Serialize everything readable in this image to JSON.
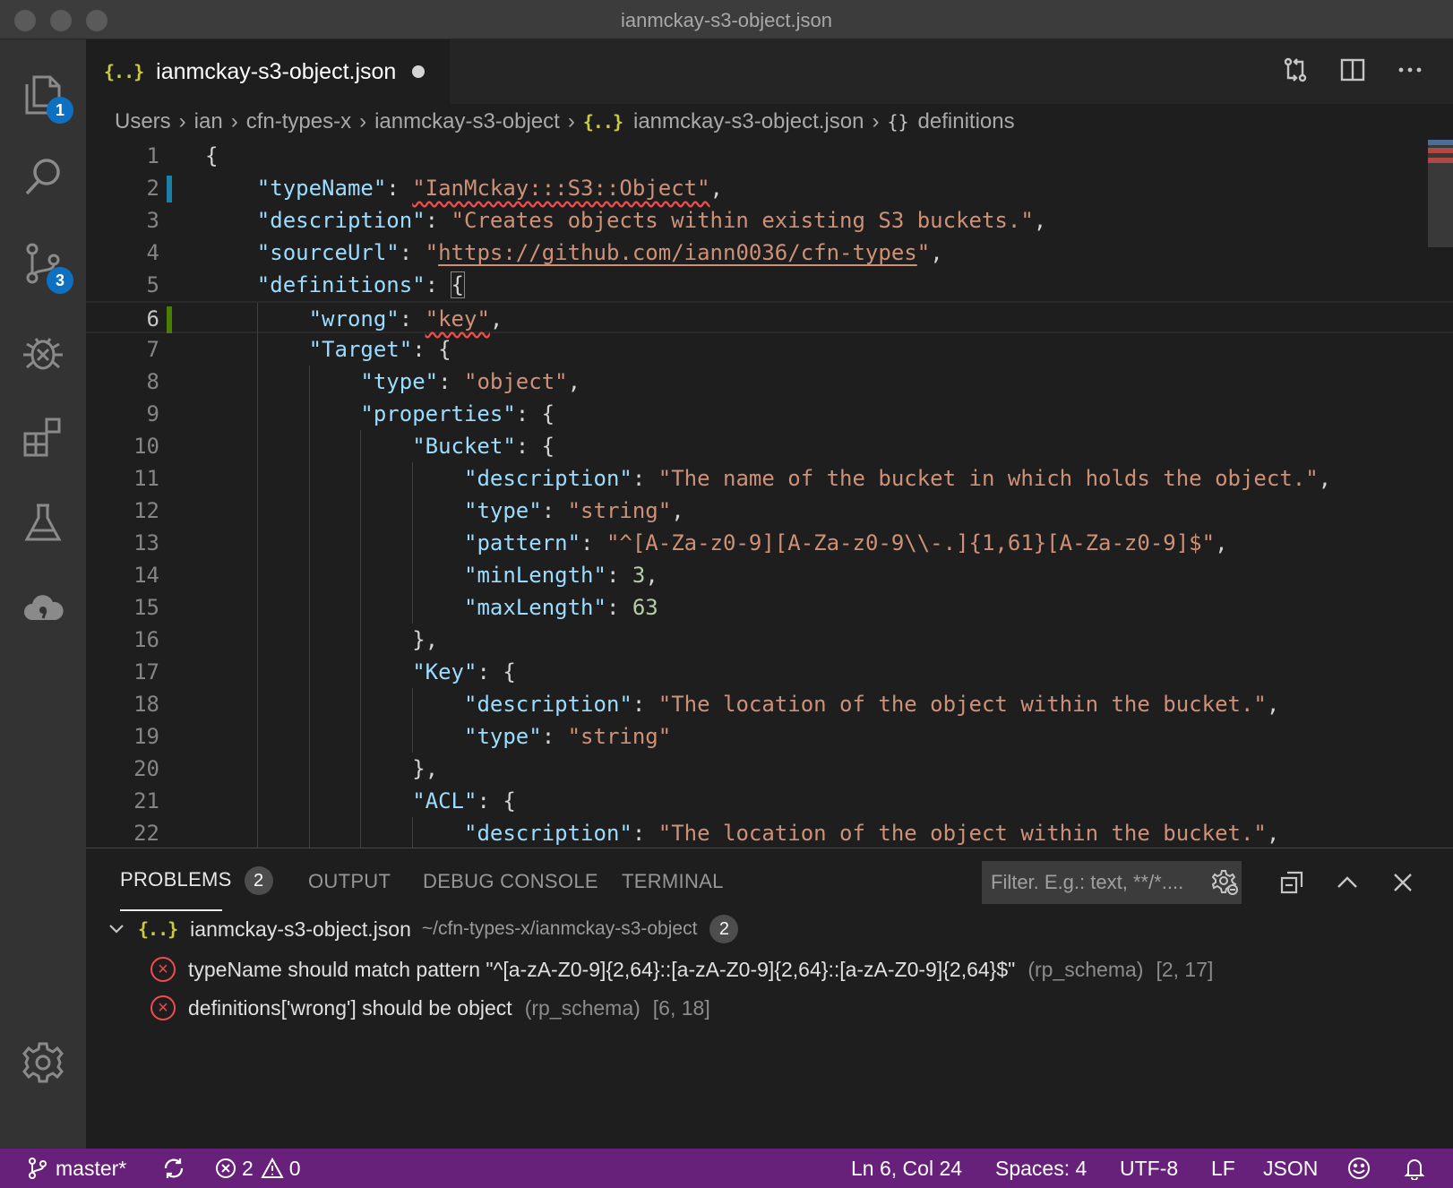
{
  "window": {
    "title": "ianmckay-s3-object.json"
  },
  "activity_bar": {
    "explorer_badge": "1",
    "scm_badge": "3"
  },
  "tab": {
    "glyph": "{..}",
    "label": "ianmckay-s3-object.json"
  },
  "breadcrumb": {
    "items": [
      "Users",
      "ian",
      "cfn-types-x",
      "ianmckay-s3-object"
    ],
    "file": "ianmckay-s3-object.json",
    "symbol_glyph": "{}",
    "symbol": "definitions"
  },
  "editor": {
    "lines": [
      {
        "n": "1",
        "indent": 0,
        "parts": [
          [
            "p",
            "{"
          ]
        ]
      },
      {
        "n": "2",
        "indent": 1,
        "parts": [
          [
            "k",
            "\"typeName\""
          ],
          [
            "p",
            ": "
          ],
          [
            "s squig",
            "\"IanMckay:::S3::Object\""
          ],
          [
            "p",
            ","
          ]
        ]
      },
      {
        "n": "3",
        "indent": 1,
        "parts": [
          [
            "k",
            "\"description\""
          ],
          [
            "p",
            ": "
          ],
          [
            "s",
            "\"Creates objects within existing S3 buckets.\""
          ],
          [
            "p",
            ","
          ]
        ]
      },
      {
        "n": "4",
        "indent": 1,
        "parts": [
          [
            "k",
            "\"sourceUrl\""
          ],
          [
            "p",
            ": "
          ],
          [
            "s",
            "\""
          ],
          [
            "s ul",
            "https://github.com/iann0036/cfn-types"
          ],
          [
            "s",
            "\""
          ],
          [
            "p",
            ","
          ]
        ]
      },
      {
        "n": "5",
        "indent": 1,
        "parts": [
          [
            "k",
            "\"definitions\""
          ],
          [
            "p",
            ": "
          ],
          [
            "p bracket-box",
            "{"
          ]
        ]
      },
      {
        "n": "6",
        "indent": 2,
        "parts": [
          [
            "k",
            "\"wrong\""
          ],
          [
            "p",
            ": "
          ],
          [
            "s squig",
            "\"key\""
          ],
          [
            "p",
            ","
          ]
        ]
      },
      {
        "n": "7",
        "indent": 2,
        "parts": [
          [
            "k",
            "\"Target\""
          ],
          [
            "p",
            ": {"
          ]
        ]
      },
      {
        "n": "8",
        "indent": 3,
        "parts": [
          [
            "k",
            "\"type\""
          ],
          [
            "p",
            ": "
          ],
          [
            "s",
            "\"object\""
          ],
          [
            "p",
            ","
          ]
        ]
      },
      {
        "n": "9",
        "indent": 3,
        "parts": [
          [
            "k",
            "\"properties\""
          ],
          [
            "p",
            ": {"
          ]
        ]
      },
      {
        "n": "10",
        "indent": 4,
        "parts": [
          [
            "k",
            "\"Bucket\""
          ],
          [
            "p",
            ": {"
          ]
        ]
      },
      {
        "n": "11",
        "indent": 5,
        "parts": [
          [
            "k",
            "\"description\""
          ],
          [
            "p",
            ": "
          ],
          [
            "s",
            "\"The name of the bucket in which holds the object.\""
          ],
          [
            "p",
            ","
          ]
        ]
      },
      {
        "n": "12",
        "indent": 5,
        "parts": [
          [
            "k",
            "\"type\""
          ],
          [
            "p",
            ": "
          ],
          [
            "s",
            "\"string\""
          ],
          [
            "p",
            ","
          ]
        ]
      },
      {
        "n": "13",
        "indent": 5,
        "parts": [
          [
            "k",
            "\"pattern\""
          ],
          [
            "p",
            ": "
          ],
          [
            "s",
            "\"^[A-Za-z0-9][A-Za-z0-9\\\\-.]{1,61}[A-Za-z0-9]$\""
          ],
          [
            "p",
            ","
          ]
        ]
      },
      {
        "n": "14",
        "indent": 5,
        "parts": [
          [
            "k",
            "\"minLength\""
          ],
          [
            "p",
            ": "
          ],
          [
            "n",
            "3"
          ],
          [
            "p",
            ","
          ]
        ]
      },
      {
        "n": "15",
        "indent": 5,
        "parts": [
          [
            "k",
            "\"maxLength\""
          ],
          [
            "p",
            ": "
          ],
          [
            "n",
            "63"
          ]
        ]
      },
      {
        "n": "16",
        "indent": 4,
        "parts": [
          [
            "p",
            "},"
          ]
        ]
      },
      {
        "n": "17",
        "indent": 4,
        "parts": [
          [
            "k",
            "\"Key\""
          ],
          [
            "p",
            ": {"
          ]
        ]
      },
      {
        "n": "18",
        "indent": 5,
        "parts": [
          [
            "k",
            "\"description\""
          ],
          [
            "p",
            ": "
          ],
          [
            "s",
            "\"The location of the object within the bucket.\""
          ],
          [
            "p",
            ","
          ]
        ]
      },
      {
        "n": "19",
        "indent": 5,
        "parts": [
          [
            "k",
            "\"type\""
          ],
          [
            "p",
            ": "
          ],
          [
            "s",
            "\"string\""
          ]
        ]
      },
      {
        "n": "20",
        "indent": 4,
        "parts": [
          [
            "p",
            "},"
          ]
        ]
      },
      {
        "n": "21",
        "indent": 4,
        "parts": [
          [
            "k",
            "\"ACL\""
          ],
          [
            "p",
            ": {"
          ]
        ]
      },
      {
        "n": "22",
        "indent": 5,
        "parts": [
          [
            "k",
            "\"description\""
          ],
          [
            "p",
            ": "
          ],
          [
            "s",
            "\"The location of the object within the bucket.\""
          ],
          [
            "p",
            ","
          ]
        ]
      }
    ]
  },
  "panel": {
    "tabs": {
      "problems": "PROBLEMS",
      "problems_count": "2",
      "output": "OUTPUT",
      "debug_console": "DEBUG CONSOLE",
      "terminal": "TERMINAL"
    },
    "filter_placeholder": "Filter. E.g.: text, **/*....",
    "file": {
      "glyph": "{..}",
      "name": "ianmckay-s3-object.json",
      "path": "~/cfn-types-x/ianmckay-s3-object",
      "count": "2"
    },
    "problems": [
      {
        "message": "typeName should match pattern \"^[a-zA-Z0-9]{2,64}::[a-zA-Z0-9]{2,64}::[a-zA-Z0-9]{2,64}$\"",
        "source": "(rp_schema)",
        "location": "[2, 17]"
      },
      {
        "message": "definitions['wrong'] should be object",
        "source": "(rp_schema)",
        "location": "[6, 18]"
      }
    ]
  },
  "statusbar": {
    "branch": "master*",
    "errors": "2",
    "warnings": "0",
    "position": "Ln 6, Col 24",
    "spaces": "Spaces: 4",
    "encoding": "UTF-8",
    "eol": "LF",
    "language": "JSON"
  },
  "colors": {
    "statusbar": "#68217a",
    "badge": "#0e70c0",
    "error": "#f14c4c",
    "json_icon": "#cbcb41",
    "key": "#9cdcfe",
    "string": "#ce9178",
    "number": "#b5cea8"
  }
}
